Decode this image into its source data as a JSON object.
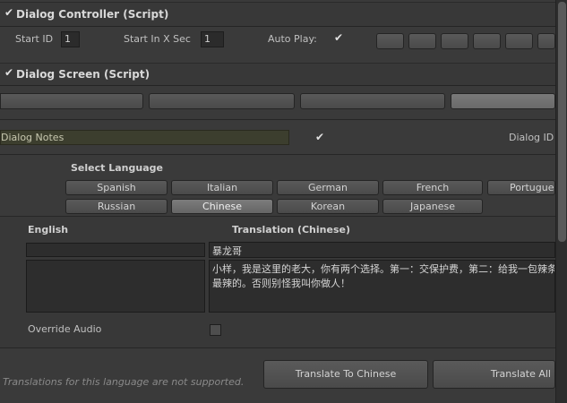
{
  "dialog_controller": {
    "title": "Dialog Controller (Script)",
    "start_id_label": "Start ID",
    "start_id_value": "1",
    "start_in_x_sec_label": "Start In X Sec",
    "start_in_x_sec_value": "1",
    "auto_play_label": "Auto Play:"
  },
  "dialog_screen": {
    "title": "Dialog Screen (Script)",
    "notes_value": "Dialog Notes",
    "dialog_id_label": "Dialog ID"
  },
  "language": {
    "select_label": "Select Language",
    "row1": [
      "Spanish",
      "Italian",
      "German",
      "French",
      "Portuguese"
    ],
    "row2": [
      "Russian",
      "Chinese",
      "Korean",
      "Japanese"
    ],
    "selected": "Chinese"
  },
  "translation": {
    "english_label": "English",
    "translation_label": "Translation (Chinese)",
    "english_name": "",
    "english_text": "",
    "translated_name": "暴龙哥",
    "translated_text_line1": "小样，我是这里的老大，你有两个选择。第一：交保护费，第二：给我一包辣条，要",
    "translated_text_line2": "最辣的。否则别怪我叫你做人！"
  },
  "override_audio_label": "Override Audio",
  "footer": {
    "note": "Translations for this language are not supported.",
    "translate_to_button": "Translate To Chinese",
    "translate_all_button": "Translate All"
  }
}
